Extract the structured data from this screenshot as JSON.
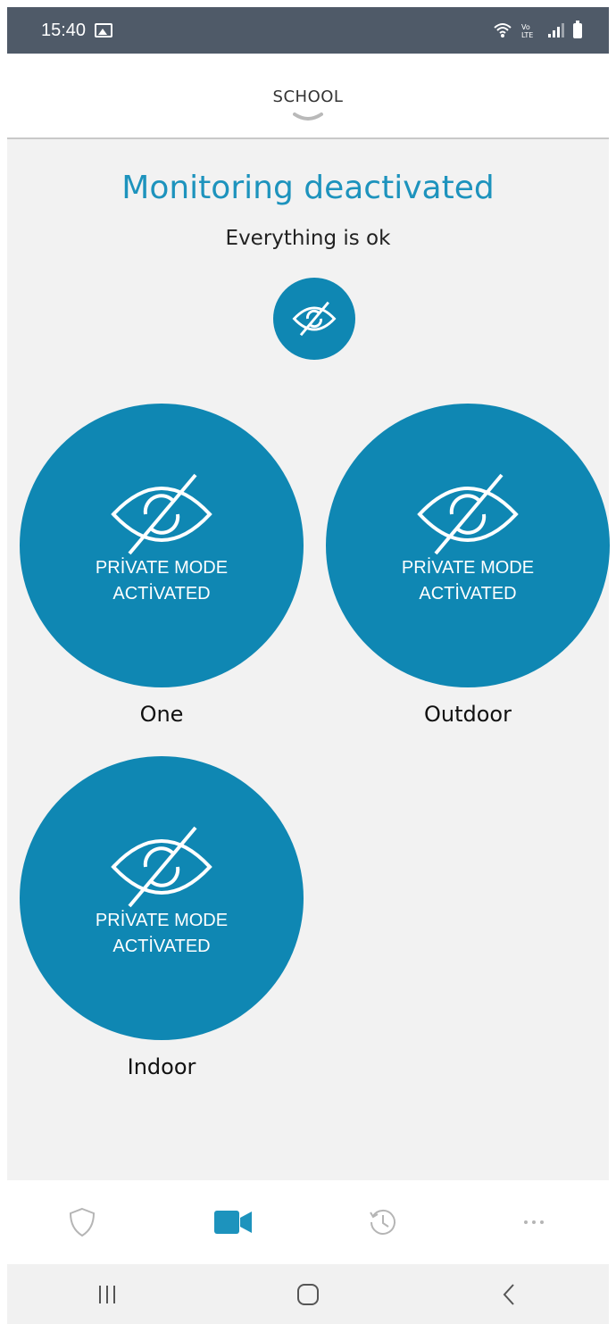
{
  "status_bar": {
    "time": "15:40",
    "icons": [
      "gallery-icon",
      "wifi-icon",
      "volte-icon",
      "signal-icon",
      "battery-icon"
    ],
    "volte_text": "VoLTE"
  },
  "header": {
    "title": "SCHOOL"
  },
  "monitoring": {
    "title": "Monitoring deactivated",
    "subtitle": "Everything is ok"
  },
  "cameras": [
    {
      "name": "One",
      "status": "PRİVATE MODE\nACTİVATED"
    },
    {
      "name": "Outdoor",
      "status": "PRİVATE MODE\nACTİVATED"
    },
    {
      "name": "Indoor",
      "status": "PRİVATE MODE\nACTİVATED"
    }
  ],
  "bottom_nav": {
    "items": [
      "shield-icon",
      "video-camera-icon",
      "history-clock-icon",
      "more-icon"
    ],
    "active": "video-camera-icon"
  },
  "system_nav": {
    "items": [
      "recent-apps-icon",
      "home-icon",
      "back-icon"
    ]
  },
  "colors": {
    "accent": "#1d93bd",
    "circle": "#0f87b3",
    "status_bar": "#4f5a68",
    "background": "#f2f2f2"
  }
}
